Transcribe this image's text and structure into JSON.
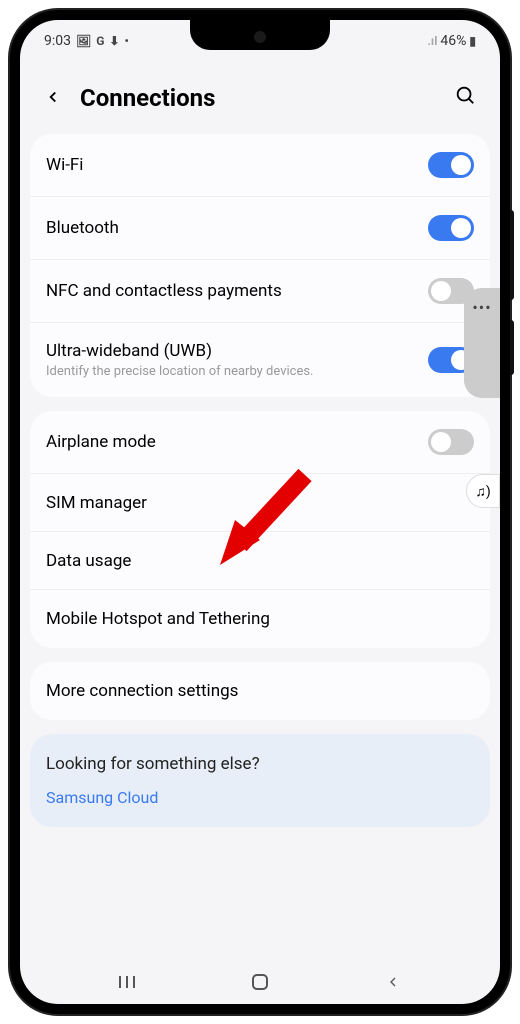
{
  "status": {
    "time": "9:03",
    "icons_left": [
      "🖼",
      "G",
      "⬇"
    ],
    "signal": "📶",
    "battery_pct": "46%",
    "battery_icon": "🔋"
  },
  "header": {
    "title": "Connections"
  },
  "groups": [
    {
      "rows": [
        {
          "label": "Wi-Fi",
          "toggle": "on"
        },
        {
          "label": "Bluetooth",
          "toggle": "on"
        },
        {
          "label": "NFC and contactless payments",
          "toggle": "off"
        },
        {
          "label": "Ultra-wideband (UWB)",
          "sub": "Identify the precise location of nearby devices.",
          "toggle": "on"
        }
      ]
    },
    {
      "rows": [
        {
          "label": "Airplane mode",
          "toggle": "off"
        },
        {
          "label": "SIM manager"
        },
        {
          "label": "Data usage"
        },
        {
          "label": "Mobile Hotspot and Tethering"
        }
      ]
    },
    {
      "rows": [
        {
          "label": "More connection settings"
        }
      ]
    }
  ],
  "suggestion": {
    "title": "Looking for something else?",
    "link": "Samsung Cloud"
  },
  "edge": {
    "dots": "•••",
    "music": "♫)"
  }
}
